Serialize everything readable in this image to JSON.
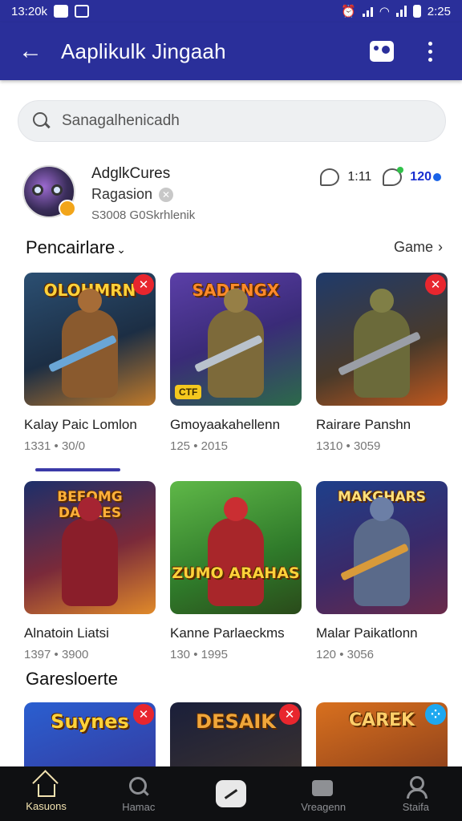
{
  "status_bar": {
    "time_left": "13:20k",
    "time_right": "2:25"
  },
  "app_bar": {
    "title": "Aaplikulk Jingaah",
    "back_icon": "arrow-left-icon",
    "camera_icon": "camera-icon",
    "more_icon": "more-vert-icon"
  },
  "search": {
    "placeholder": "Sanagalhenicadh",
    "value": ""
  },
  "profile": {
    "name": "AdglkCures",
    "subtitle": "Ragasion",
    "meta": "S3008 G0Skrhlenik",
    "stat_1": "1:11",
    "stat_2": "120"
  },
  "section_1": {
    "title": "Pencairlare",
    "more_label": "Game"
  },
  "section_2": {
    "title": "Garesloerte"
  },
  "cards_row_1": [
    {
      "title": "Kalay Paic Lomlon",
      "meta": "1331 • 30/0",
      "banner": "OLOHMRN"
    },
    {
      "title": "Gmoyaakahellenn",
      "meta": "125 • 2015",
      "banner": "SADENGX",
      "badge": "CTF"
    },
    {
      "title": "Rairare Panshn",
      "meta": "1310 • 3059",
      "banner": ""
    }
  ],
  "cards_row_2": [
    {
      "title": "Alnatoin Liatsi",
      "meta": "1397 • 3900",
      "banner": "BEFOMG DAGKES"
    },
    {
      "title": "Kanne Parlaeckms",
      "meta": "130 • 1995",
      "banner": "ZUMO ARAHAS"
    },
    {
      "title": "Malar Paikatlonn",
      "meta": "120 • 3056",
      "banner": "MAKGHARS"
    }
  ],
  "cards_row_3": [
    {
      "banner": "Suynes"
    },
    {
      "banner": "DESAIK"
    },
    {
      "banner": "CAREK"
    }
  ],
  "bottom_nav": [
    {
      "label": "Kasuons",
      "icon": "home-icon"
    },
    {
      "label": "Hamac",
      "icon": "search-icon"
    },
    {
      "label": "",
      "icon": "compass-icon"
    },
    {
      "label": "Vreagenn",
      "icon": "bag-icon"
    },
    {
      "label": "Staifa",
      "icon": "user-icon"
    }
  ],
  "colors": {
    "primary": "#2a2f9a",
    "tag_red": "#e8262e",
    "nav_bg": "#0f1012"
  }
}
